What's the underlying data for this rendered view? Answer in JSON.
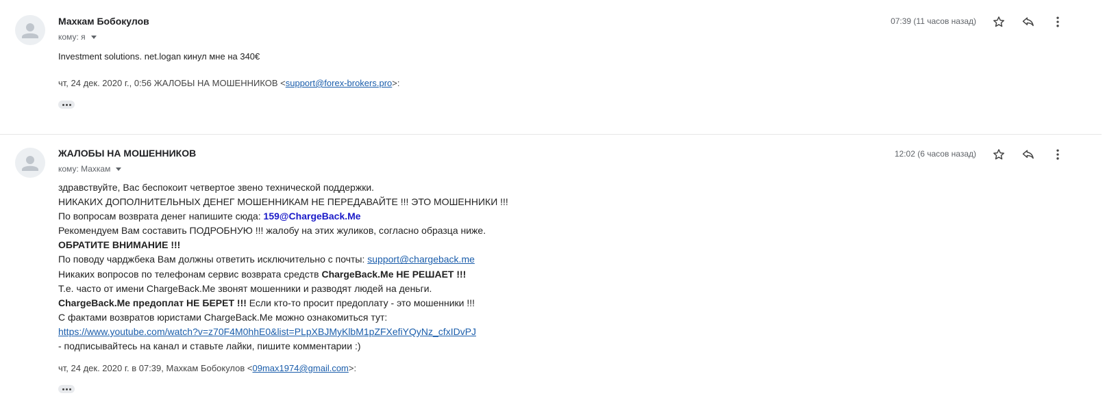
{
  "messages": [
    {
      "sender": "Махкам Бобокулов",
      "to_label": "кому: я",
      "time": "07:39 (11 часов назад)",
      "body_line": "Investment  solutions. net.logan кинул мне на 340€",
      "quote_prefix": "чт, 24 дек. 2020 г., 0:56 ЖАЛОБЫ НА МОШЕННИКОВ <",
      "quote_email": "support@forex-brokers.pro",
      "quote_suffix": ">:"
    },
    {
      "sender": "ЖАЛОБЫ НА МОШЕННИКОВ",
      "to_label": "кому: Махкам",
      "time": "12:02 (6 часов назад)",
      "lines": {
        "l1": "здравствуйте, Вас беспокоит четвертое звено технической поддержки.",
        "l2": "НИКАКИХ ДОПОЛНИТЕЛЬНЫХ ДЕНЕГ МОШЕННИКАМ НЕ ПЕРЕДАВАЙТЕ !!! ЭТО МОШЕННИКИ !!!",
        "l3_text": "По вопросам возврата денег напишите сюда: ",
        "l3_email": "159@ChargeBack.Me",
        "l4": "Рекомендуем Вам составить ПОДРОБНУЮ !!! жалобу на этих жуликов, согласно образца ниже.",
        "l5": "ОБРАТИТЕ ВНИМАНИЕ !!!",
        "l6_text": "По поводу чарджбека Вам должны ответить исключительно с почты: ",
        "l6_link": "support@chargeback.me",
        "l7_text": "Никаких вопросов по телефонам сервис возврата средств ",
        "l7_bold": "ChargeBack.Me НЕ РЕШАЕТ !!!",
        "l8": "Т.е. часто от имени ChargeBack.Me звонят мошенники и разводят людей на деньги.",
        "l9_bold": "ChargeBack.Me предоплат НЕ БЕРЕТ !!!",
        "l9_text": " Если кто-то просит предоплату - это мошенники !!!",
        "l10": "С фактами возвратов юристами ChargeBack.Me можно ознакомиться тут:",
        "l11_link": "https://www.youtube.com/watch?v=z70F4M0hhE0&list=PLpXBJMyKlbM1pZFXefiYQyNz_cfxIDvPJ",
        "l12": " - подписывайтесь на канал и ставьте лайки, пишите комментарии :)"
      },
      "quote_prefix": "чт, 24 дек. 2020 г. в 07:39, Махкам Бобокулов <",
      "quote_email": "09max1974@gmail.com",
      "quote_suffix": ">:"
    }
  ],
  "icons": {
    "star": "star-icon",
    "reply": "reply-icon",
    "more": "more-vert-icon",
    "avatar": "person-icon"
  },
  "colors": {
    "link": "#1a5dab",
    "email_highlight": "#1a1ac8",
    "secondary_text": "#5f6368"
  }
}
